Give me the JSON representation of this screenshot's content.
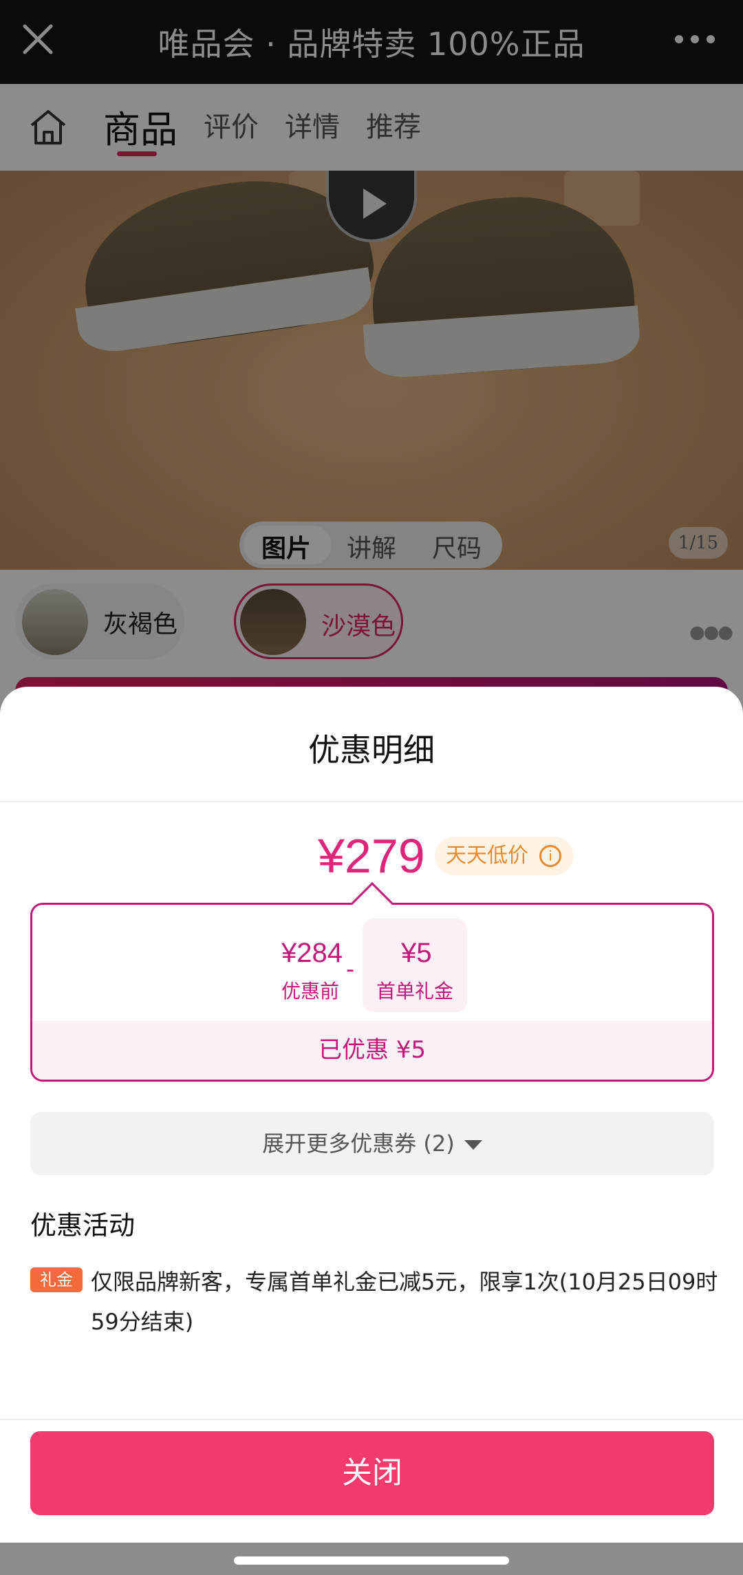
{
  "topbar": {
    "title": "唯品会 · 品牌特卖 100%正品",
    "close_icon": "close-icon",
    "more_icon": "more-dots-icon"
  },
  "page": {
    "tabs": [
      {
        "label": "商品",
        "active": true
      },
      {
        "label": "评价",
        "active": false
      },
      {
        "label": "详情",
        "active": false
      },
      {
        "label": "推荐",
        "active": false
      }
    ],
    "media_segments": [
      "图片",
      "讲解",
      "尺码"
    ],
    "image_counter": "1/15",
    "colors": [
      {
        "label": "灰褐色",
        "selected": false
      },
      {
        "label": "沙漠色",
        "selected": true
      }
    ]
  },
  "sheet": {
    "title": "优惠明细",
    "price": "¥279",
    "price_tag": "天天低价",
    "breakdown": {
      "original_value": "¥284",
      "original_label": "优惠前",
      "operator": "-",
      "discount_value": "¥5",
      "discount_label": "首单礼金",
      "saved_text": "已优惠 ¥5"
    },
    "expand_label": "展开更多优惠券 (2)",
    "activity_title": "优惠活动",
    "activity": {
      "tag": "礼金",
      "text": "仅限品牌新客，专属首单礼金已减5元，限享1次(10月25日09时59分结束)"
    },
    "close_button": "关闭"
  },
  "colors": {
    "accent": "#e0245e",
    "price": "#e0247a",
    "close_button": "#f23a6c",
    "tag_orange": "#f46a3b"
  }
}
